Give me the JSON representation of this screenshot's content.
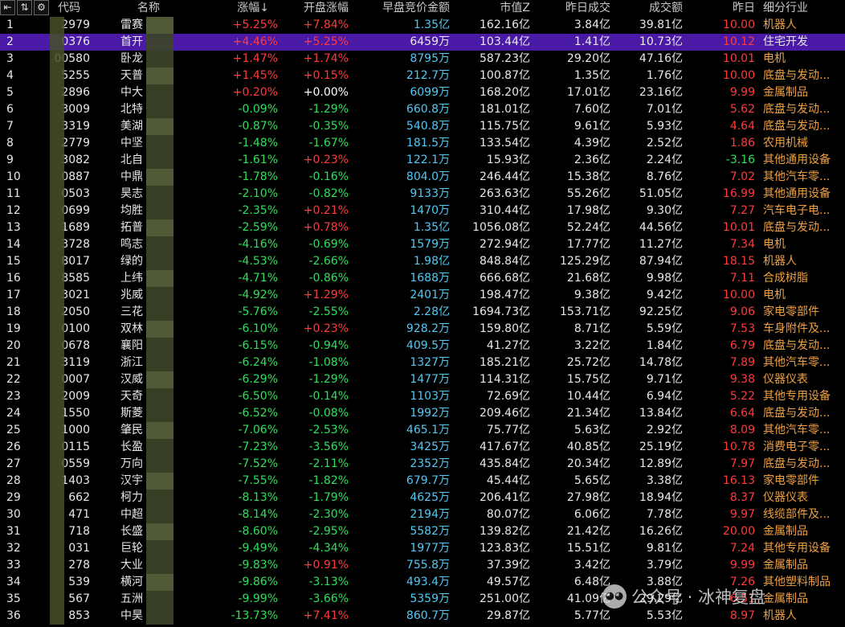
{
  "toolbar": {
    "icons": [
      "first-page-icon",
      "sort-icon",
      "gear-icon"
    ]
  },
  "columns": {
    "idx": "",
    "code": "代码",
    "name": "名称",
    "chg": "涨幅",
    "open": "开盘涨幅",
    "auction": "早盘竞价金额",
    "mcap": "市值Z",
    "yvol": "昨日成交",
    "vol": "成交额",
    "yday": "昨日",
    "industry": "细分行业"
  },
  "sort_arrow": "↓",
  "colors": {
    "up": "#ff3b3b",
    "down": "#2fe05a",
    "cyan": "#52c8f5",
    "selected": "#4a1aa6"
  },
  "selected_index": 1,
  "rows": [
    {
      "idx": "1",
      "code": "2979",
      "name": "雷赛",
      "chg": "+5.25%",
      "open": "+7.84%",
      "auction": "1.35亿",
      "mcap": "162.16亿",
      "yvol": "3.84亿",
      "vol": "39.81亿",
      "yday": "10.00",
      "industry": "机器人"
    },
    {
      "idx": "2",
      "code": "0376",
      "name": "首开",
      "chg": "+4.46%",
      "open": "+5.25%",
      "auction": "6459万",
      "mcap": "103.44亿",
      "yvol": "1.41亿",
      "vol": "10.73亿",
      "yday": "10.12",
      "industry": "住宅开发"
    },
    {
      "idx": "3",
      "code": "00580",
      "name": "卧龙",
      "chg": "+1.47%",
      "open": "+1.74%",
      "auction": "8795万",
      "mcap": "587.23亿",
      "yvol": "29.20亿",
      "vol": "47.16亿",
      "yday": "10.01",
      "industry": "电机"
    },
    {
      "idx": "4",
      "code": "5255",
      "name": "天普",
      "chg": "+1.45%",
      "open": "+0.15%",
      "auction": "212.7万",
      "mcap": "100.87亿",
      "yvol": "1.35亿",
      "vol": "1.76亿",
      "yday": "10.00",
      "industry": "底盘与发动..."
    },
    {
      "idx": "5",
      "code": "2896",
      "name": "中大",
      "chg": "+0.20%",
      "open": "+0.00%",
      "auction": "6099万",
      "mcap": "168.20亿",
      "yvol": "17.01亿",
      "vol": "23.16亿",
      "yday": "9.99",
      "industry": "金属制品"
    },
    {
      "idx": "6",
      "code": "3009",
      "name": "北特",
      "chg": "-0.09%",
      "open": "-1.29%",
      "auction": "660.8万",
      "mcap": "181.01亿",
      "yvol": "7.60亿",
      "vol": "7.01亿",
      "yday": "5.62",
      "industry": "底盘与发动..."
    },
    {
      "idx": "7",
      "code": "3319",
      "name": "美湖",
      "chg": "-0.87%",
      "open": "-0.35%",
      "auction": "540.8万",
      "mcap": "115.75亿",
      "yvol": "9.61亿",
      "vol": "5.93亿",
      "yday": "4.64",
      "industry": "底盘与发动..."
    },
    {
      "idx": "8",
      "code": "2779",
      "name": "中坚",
      "chg": "-1.48%",
      "open": "-1.67%",
      "auction": "181.5万",
      "mcap": "133.54亿",
      "yvol": "4.39亿",
      "vol": "2.52亿",
      "yday": "1.86",
      "industry": "农用机械"
    },
    {
      "idx": "9",
      "code": "3082",
      "name": "北自",
      "chg": "-1.61%",
      "open": "+0.23%",
      "auction": "122.1万",
      "mcap": "15.93亿",
      "yvol": "2.36亿",
      "vol": "2.24亿",
      "yday": "-3.16",
      "industry": "其他通用设备"
    },
    {
      "idx": "10",
      "code": "0887",
      "name": "中鼎",
      "chg": "-1.78%",
      "open": "-0.16%",
      "auction": "804.0万",
      "mcap": "246.44亿",
      "yvol": "15.38亿",
      "vol": "8.76亿",
      "yday": "7.02",
      "industry": "其他汽车零..."
    },
    {
      "idx": "11",
      "code": "0503",
      "name": "昊志",
      "chg": "-2.10%",
      "open": "-0.82%",
      "auction": "9133万",
      "mcap": "263.63亿",
      "yvol": "55.26亿",
      "vol": "51.05亿",
      "yday": "16.99",
      "industry": "其他通用设备"
    },
    {
      "idx": "12",
      "code": "0699",
      "name": "均胜",
      "chg": "-2.35%",
      "open": "+0.21%",
      "auction": "1470万",
      "mcap": "310.44亿",
      "yvol": "17.98亿",
      "vol": "9.30亿",
      "yday": "7.27",
      "industry": "汽车电子电..."
    },
    {
      "idx": "13",
      "code": "1689",
      "name": "拓普",
      "chg": "-2.59%",
      "open": "+0.78%",
      "auction": "1.35亿",
      "mcap": "1056.08亿",
      "yvol": "52.24亿",
      "vol": "44.56亿",
      "yday": "10.01",
      "industry": "底盘与发动..."
    },
    {
      "idx": "14",
      "code": "3728",
      "name": "鸣志",
      "chg": "-4.16%",
      "open": "-0.69%",
      "auction": "1579万",
      "mcap": "272.94亿",
      "yvol": "17.77亿",
      "vol": "11.27亿",
      "yday": "7.34",
      "industry": "电机"
    },
    {
      "idx": "15",
      "code": "8017",
      "name": "绿的",
      "chg": "-4.53%",
      "open": "-2.66%",
      "auction": "1.98亿",
      "mcap": "848.84亿",
      "yvol": "125.29亿",
      "vol": "87.94亿",
      "yday": "18.15",
      "industry": "机器人"
    },
    {
      "idx": "16",
      "code": "8585",
      "name": "上纬",
      "chg": "-4.71%",
      "open": "-0.86%",
      "auction": "1688万",
      "mcap": "666.68亿",
      "yvol": "21.68亿",
      "vol": "9.98亿",
      "yday": "7.11",
      "industry": "合成树脂"
    },
    {
      "idx": "17",
      "code": "3021",
      "name": "兆威",
      "chg": "-4.92%",
      "open": "+1.29%",
      "auction": "2401万",
      "mcap": "198.47亿",
      "yvol": "9.38亿",
      "vol": "9.42亿",
      "yday": "10.00",
      "industry": "电机"
    },
    {
      "idx": "18",
      "code": "2050",
      "name": "三花",
      "chg": "-5.76%",
      "open": "-2.55%",
      "auction": "2.28亿",
      "mcap": "1694.73亿",
      "yvol": "153.71亿",
      "vol": "92.25亿",
      "yday": "9.06",
      "industry": "家电零部件"
    },
    {
      "idx": "19",
      "code": "0100",
      "name": "双林",
      "chg": "-6.10%",
      "open": "+0.23%",
      "auction": "928.2万",
      "mcap": "159.80亿",
      "yvol": "8.71亿",
      "vol": "5.59亿",
      "yday": "7.53",
      "industry": "车身附件及..."
    },
    {
      "idx": "20",
      "code": "0678",
      "name": "襄阳",
      "chg": "-6.15%",
      "open": "-0.94%",
      "auction": "409.5万",
      "mcap": "41.27亿",
      "yvol": "3.22亿",
      "vol": "1.84亿",
      "yday": "6.79",
      "industry": "底盘与发动..."
    },
    {
      "idx": "21",
      "code": "3119",
      "name": "浙江",
      "chg": "-6.24%",
      "open": "-1.08%",
      "auction": "1327万",
      "mcap": "185.21亿",
      "yvol": "25.72亿",
      "vol": "14.78亿",
      "yday": "7.89",
      "industry": "其他汽车零..."
    },
    {
      "idx": "22",
      "code": "0007",
      "name": "汉威",
      "chg": "-6.29%",
      "open": "-1.29%",
      "auction": "1477万",
      "mcap": "114.31亿",
      "yvol": "15.75亿",
      "vol": "9.71亿",
      "yday": "9.38",
      "industry": "仪器仪表"
    },
    {
      "idx": "23",
      "code": "2009",
      "name": "天奇",
      "chg": "-6.50%",
      "open": "-0.14%",
      "auction": "1103万",
      "mcap": "72.69亿",
      "yvol": "10.44亿",
      "vol": "6.94亿",
      "yday": "5.22",
      "industry": "其他专用设备"
    },
    {
      "idx": "24",
      "code": "1550",
      "name": "斯菱",
      "chg": "-6.52%",
      "open": "-0.08%",
      "auction": "1992万",
      "mcap": "209.46亿",
      "yvol": "21.34亿",
      "vol": "13.84亿",
      "yday": "6.64",
      "industry": "底盘与发动..."
    },
    {
      "idx": "25",
      "code": "1000",
      "name": "肇民",
      "chg": "-7.06%",
      "open": "-2.53%",
      "auction": "465.1万",
      "mcap": "75.77亿",
      "yvol": "5.63亿",
      "vol": "2.92亿",
      "yday": "8.09",
      "industry": "其他汽车零..."
    },
    {
      "idx": "26",
      "code": "0115",
      "name": "长盈",
      "chg": "-7.23%",
      "open": "-3.56%",
      "auction": "3425万",
      "mcap": "417.67亿",
      "yvol": "40.85亿",
      "vol": "25.19亿",
      "yday": "10.78",
      "industry": "消费电子零..."
    },
    {
      "idx": "27",
      "code": "0559",
      "name": "万向",
      "chg": "-7.52%",
      "open": "-2.11%",
      "auction": "2352万",
      "mcap": "435.84亿",
      "yvol": "20.34亿",
      "vol": "12.89亿",
      "yday": "7.97",
      "industry": "底盘与发动..."
    },
    {
      "idx": "28",
      "code": "1403",
      "name": "汉宇",
      "chg": "-7.55%",
      "open": "-1.82%",
      "auction": "679.7万",
      "mcap": "45.44亿",
      "yvol": "5.65亿",
      "vol": "3.38亿",
      "yday": "16.13",
      "industry": "家电零部件"
    },
    {
      "idx": "29",
      "code": "662",
      "name": "柯力",
      "chg": "-8.13%",
      "open": "-1.79%",
      "auction": "4625万",
      "mcap": "206.41亿",
      "yvol": "27.98亿",
      "vol": "18.94亿",
      "yday": "8.37",
      "industry": "仪器仪表"
    },
    {
      "idx": "30",
      "code": "471",
      "name": "中超",
      "chg": "-8.14%",
      "open": "-2.30%",
      "auction": "2194万",
      "mcap": "80.07亿",
      "yvol": "6.06亿",
      "vol": "7.78亿",
      "yday": "9.97",
      "industry": "线缆部件及..."
    },
    {
      "idx": "31",
      "code": "718",
      "name": "长盛",
      "chg": "-8.60%",
      "open": "-2.95%",
      "auction": "5582万",
      "mcap": "139.82亿",
      "yvol": "21.42亿",
      "vol": "16.26亿",
      "yday": "20.00",
      "industry": "金属制品"
    },
    {
      "idx": "32",
      "code": "031",
      "name": "巨轮",
      "chg": "-9.49%",
      "open": "-4.34%",
      "auction": "1977万",
      "mcap": "123.83亿",
      "yvol": "15.51亿",
      "vol": "9.81亿",
      "yday": "7.24",
      "industry": "其他专用设备"
    },
    {
      "idx": "33",
      "code": "278",
      "name": "大业",
      "chg": "-9.83%",
      "open": "+0.91%",
      "auction": "755.8万",
      "mcap": "37.39亿",
      "yvol": "3.42亿",
      "vol": "3.79亿",
      "yday": "9.99",
      "industry": "金属制品"
    },
    {
      "idx": "34",
      "code": "539",
      "name": "横河",
      "chg": "-9.86%",
      "open": "-3.13%",
      "auction": "493.4万",
      "mcap": "49.57亿",
      "yvol": "6.48亿",
      "vol": "3.88亿",
      "yday": "7.26",
      "industry": "其他塑料制品"
    },
    {
      "idx": "35",
      "code": "567",
      "name": "五洲",
      "chg": "-9.99%",
      "open": "-3.66%",
      "auction": "5359万",
      "mcap": "251.00亿",
      "yvol": "41.09亿",
      "vol": "29.29亿",
      "yday": "6.51",
      "industry": "金属制品"
    },
    {
      "idx": "36",
      "code": "853",
      "name": "中昊",
      "chg": "-13.73%",
      "open": "+7.41%",
      "auction": "860.7万",
      "mcap": "29.87亿",
      "yvol": "5.77亿",
      "vol": "5.53亿",
      "yday": "8.97",
      "industry": "机器人"
    }
  ],
  "watermark": {
    "icon": "wechat-icon",
    "text": "公众号 · 冰神复盘"
  }
}
